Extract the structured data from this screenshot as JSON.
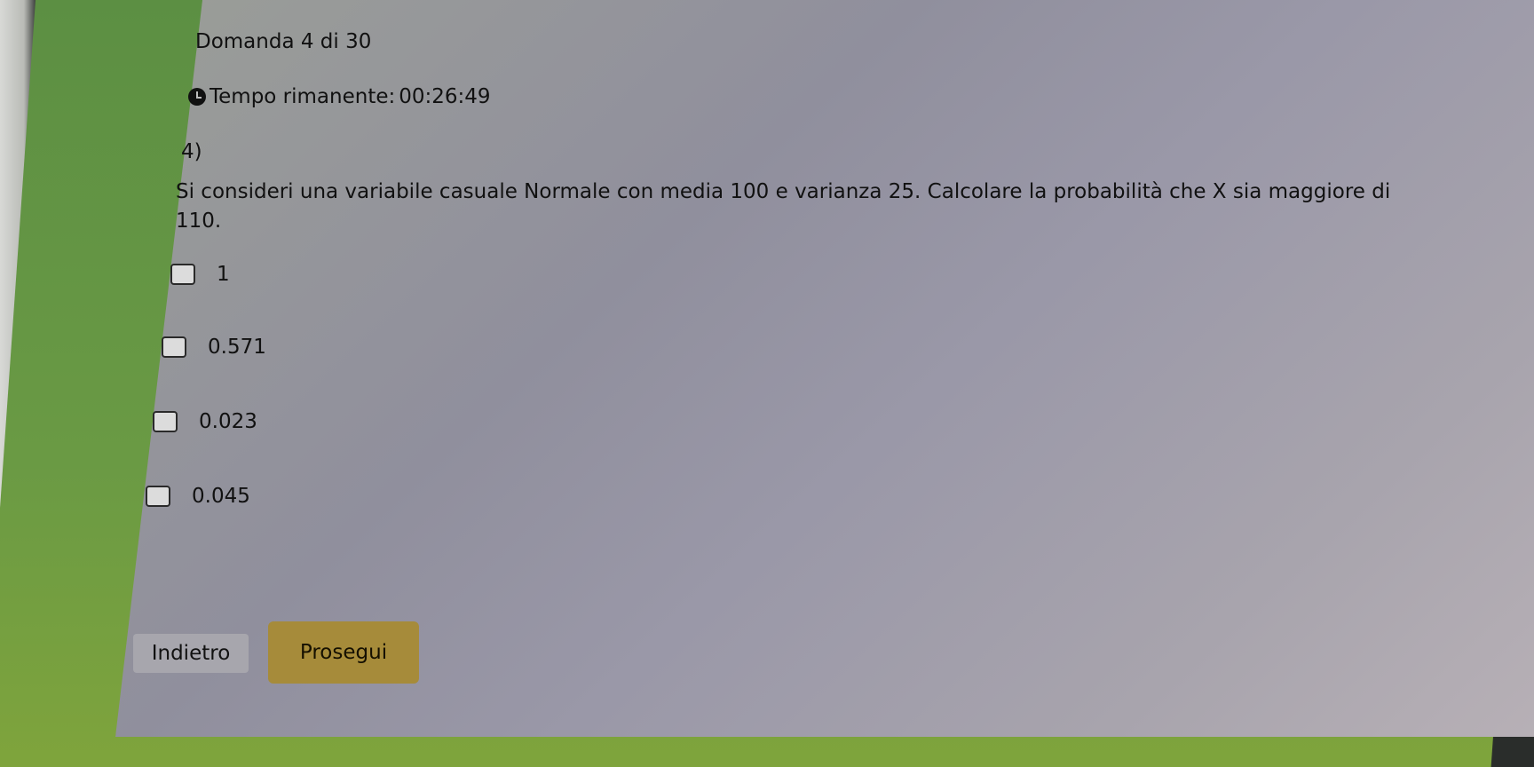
{
  "question": {
    "counter": "Domanda 4 di 30",
    "timer_label": "Tempo rimanente:",
    "timer_value": "00:26:49",
    "number": "4)",
    "text": "Si consideri una variabile casuale Normale con media 100 e varianza 25. Calcolare la probabilità che X sia maggiore di 110."
  },
  "options": [
    {
      "label": "1"
    },
    {
      "label": "0.571"
    },
    {
      "label": "0.023"
    },
    {
      "label": "0.045"
    }
  ],
  "buttons": {
    "back_label": "Indietro",
    "next_label": "Prosegui"
  },
  "colors": {
    "accent_button": "#a68b3a"
  }
}
